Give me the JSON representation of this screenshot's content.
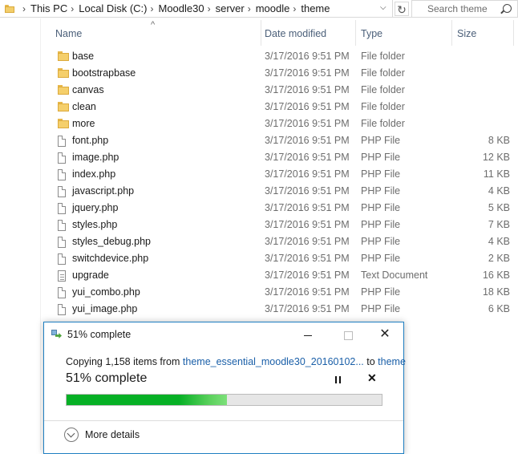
{
  "breadcrumbs": [
    "This PC",
    "Local Disk (C:)",
    "Moodle30",
    "server",
    "moodle",
    "theme"
  ],
  "search": {
    "placeholder": "Search theme"
  },
  "columns": {
    "name": "Name",
    "date": "Date modified",
    "type": "Type",
    "size": "Size"
  },
  "files": [
    {
      "name": "base",
      "date": "3/17/2016 9:51 PM",
      "type": "File folder",
      "size": "",
      "icon": "folder-icon"
    },
    {
      "name": "bootstrapbase",
      "date": "3/17/2016 9:51 PM",
      "type": "File folder",
      "size": "",
      "icon": "folder-icon"
    },
    {
      "name": "canvas",
      "date": "3/17/2016 9:51 PM",
      "type": "File folder",
      "size": "",
      "icon": "folder-icon"
    },
    {
      "name": "clean",
      "date": "3/17/2016 9:51 PM",
      "type": "File folder",
      "size": "",
      "icon": "folder-icon"
    },
    {
      "name": "more",
      "date": "3/17/2016 9:51 PM",
      "type": "File folder",
      "size": "",
      "icon": "folder-icon"
    },
    {
      "name": "font.php",
      "date": "3/17/2016 9:51 PM",
      "type": "PHP File",
      "size": "8 KB",
      "icon": "file-icon"
    },
    {
      "name": "image.php",
      "date": "3/17/2016 9:51 PM",
      "type": "PHP File",
      "size": "12 KB",
      "icon": "file-icon"
    },
    {
      "name": "index.php",
      "date": "3/17/2016 9:51 PM",
      "type": "PHP File",
      "size": "11 KB",
      "icon": "file-icon"
    },
    {
      "name": "javascript.php",
      "date": "3/17/2016 9:51 PM",
      "type": "PHP File",
      "size": "4 KB",
      "icon": "file-icon"
    },
    {
      "name": "jquery.php",
      "date": "3/17/2016 9:51 PM",
      "type": "PHP File",
      "size": "5 KB",
      "icon": "file-icon"
    },
    {
      "name": "styles.php",
      "date": "3/17/2016 9:51 PM",
      "type": "PHP File",
      "size": "7 KB",
      "icon": "file-icon"
    },
    {
      "name": "styles_debug.php",
      "date": "3/17/2016 9:51 PM",
      "type": "PHP File",
      "size": "4 KB",
      "icon": "file-icon"
    },
    {
      "name": "switchdevice.php",
      "date": "3/17/2016 9:51 PM",
      "type": "PHP File",
      "size": "2 KB",
      "icon": "file-icon"
    },
    {
      "name": "upgrade",
      "date": "3/17/2016 9:51 PM",
      "type": "Text Document",
      "size": "16 KB",
      "icon": "text-document-icon"
    },
    {
      "name": "yui_combo.php",
      "date": "3/17/2016 9:51 PM",
      "type": "PHP File",
      "size": "18 KB",
      "icon": "file-icon"
    },
    {
      "name": "yui_image.php",
      "date": "3/17/2016 9:51 PM",
      "type": "PHP File",
      "size": "6 KB",
      "icon": "file-icon"
    }
  ],
  "dialog": {
    "title": "51% complete",
    "copy_prefix": "Copying 1,158 items from ",
    "source": "theme_essential_moodle30_20160102...",
    "to_word": " to ",
    "destination": "theme",
    "percent_text": "51% complete",
    "progress_percent": 51,
    "more_details": "More details",
    "progress_color": "#06b025"
  }
}
